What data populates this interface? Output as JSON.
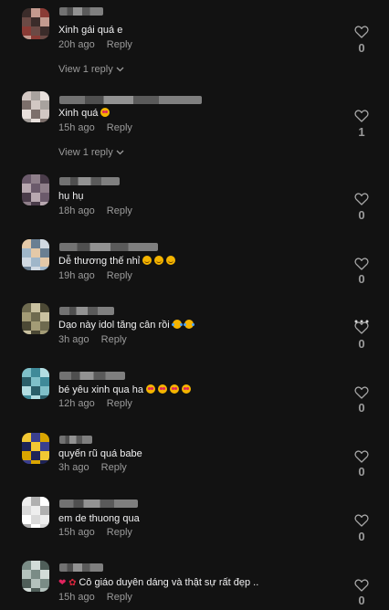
{
  "comments": [
    {
      "text": "Xinh gái quá e",
      "emoji": [],
      "time": "20h ago",
      "reply": "Reply",
      "likes": "0",
      "view_replies": "View 1 reply",
      "avatar": [
        "#3b2c2a",
        "#6b4a45",
        "#8a3b35",
        "#c49a8f"
      ]
    },
    {
      "text": "Xinh quá",
      "emoji": [
        "heart-eyes"
      ],
      "time": "15h ago",
      "reply": "Reply",
      "likes": "1",
      "view_replies": "View 1 reply",
      "avatar": [
        "#a8a29e",
        "#d2c7c3",
        "#7c6f6b",
        "#e8e0dc"
      ]
    },
    {
      "text": "hụ hụ",
      "emoji": [],
      "time": "18h ago",
      "reply": "Reply",
      "likes": "0",
      "avatar": [
        "#4a3c4a",
        "#8f7f8a",
        "#6b5a6b",
        "#b8a8b0"
      ]
    },
    {
      "text": "Dễ thương thế nhỉ",
      "emoji": [
        "smile",
        "smile",
        "smile"
      ],
      "time": "19h ago",
      "reply": "Reply",
      "likes": "0",
      "avatar": [
        "#9fb6c9",
        "#d0d9e2",
        "#6a7f92",
        "#e4c9a8"
      ]
    },
    {
      "text": "Dạo này idol tăng cân rồi",
      "emoji": [
        "joy",
        "joy"
      ],
      "time": "3h ago",
      "reply": "Reply",
      "likes": "0",
      "avatar": [
        "#6e6a4f",
        "#a39c76",
        "#4c4935",
        "#c9c1a0"
      ]
    },
    {
      "text": "bé yêu xinh qua ha",
      "emoji": [
        "heart-eyes",
        "heart-eyes",
        "heart-eyes",
        "heart-eyes"
      ],
      "time": "12h ago",
      "reply": "Reply",
      "likes": "0",
      "avatar": [
        "#3f8a99",
        "#7fc0c9",
        "#2b5f6a",
        "#b2dde2"
      ]
    },
    {
      "text": "quyến rũ quá babe",
      "emoji": [],
      "time": "3h ago",
      "reply": "Reply",
      "likes": "0",
      "avatar": [
        "#d9a500",
        "#3a3f8f",
        "#f2c833",
        "#1e2357"
      ]
    },
    {
      "text": "em de thuong qua",
      "emoji": [],
      "time": "15h ago",
      "reply": "Reply",
      "likes": "0",
      "avatar": [
        "#d9d9d9",
        "#ffffff",
        "#b0b0b0",
        "#eeeeee"
      ]
    },
    {
      "text": "Cô giáo duyên dáng và thật sự rất đẹp ..",
      "emoji": [],
      "prefix": true,
      "time": "15h ago",
      "reply": "Reply",
      "likes": "0",
      "avatar": [
        "#7a8c86",
        "#b4c2bd",
        "#4f5e59",
        "#d2dcd8"
      ]
    }
  ]
}
